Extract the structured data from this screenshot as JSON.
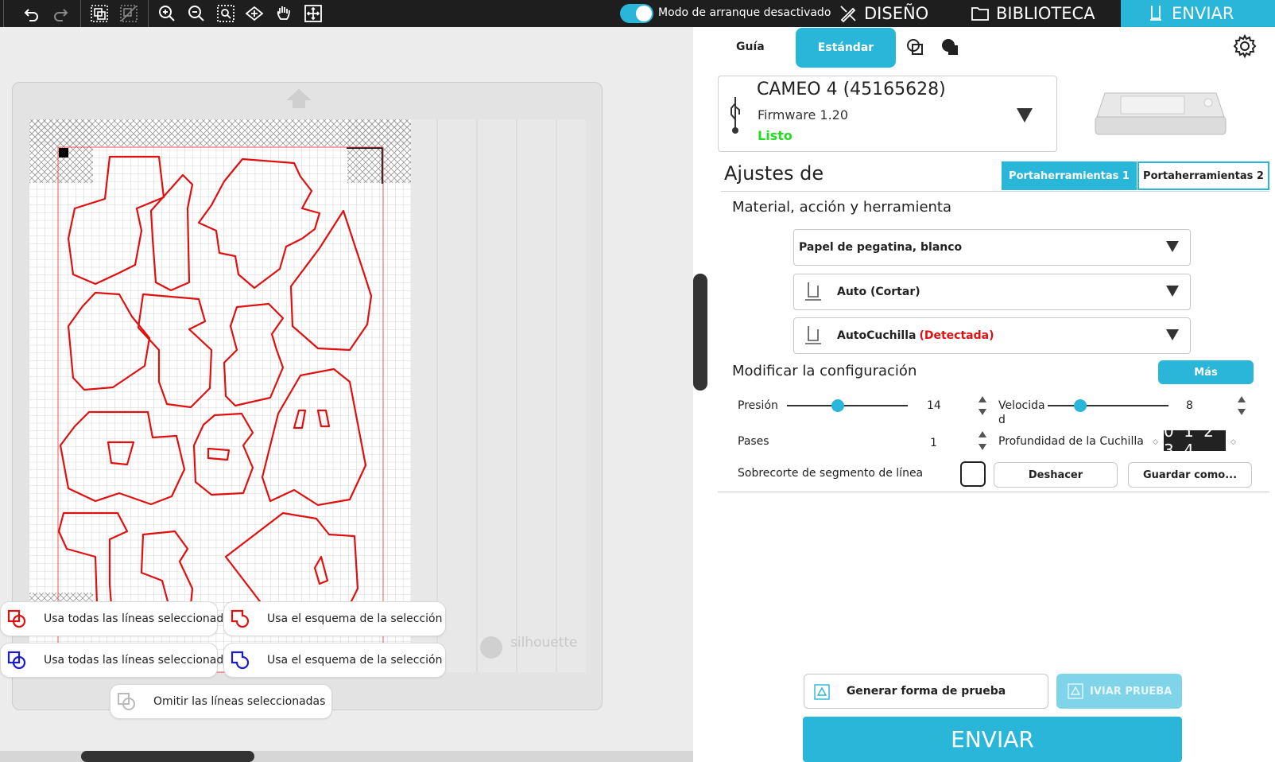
{
  "topbar": {
    "mode_label": "Modo de arranque desactivado",
    "tabs": [
      {
        "label": "DISEÑO"
      },
      {
        "label": "BIBLIOTECA"
      },
      {
        "label": "ENVIAR"
      }
    ]
  },
  "canvas": {
    "brand": "silhouette",
    "options": [
      {
        "label": "Usa todas las líneas seleccionadas",
        "color": "#e01010"
      },
      {
        "label": "Usa el esquema de la selección",
        "color": "#e01010"
      },
      {
        "label": "Usa todas las líneas seleccionadas",
        "color": "#1a1ad0"
      },
      {
        "label": "Usa el esquema de la selección",
        "color": "#1a1ad0"
      },
      {
        "label": "Omitir las líneas seleccionadas",
        "color": "#bbbbbb"
      }
    ]
  },
  "panel": {
    "tabs": {
      "guide": "Guía",
      "standard": "Estándar"
    },
    "machine": {
      "name": "CAMEO 4 (45165628)",
      "firmware": "Firmware 1.20",
      "status": "Listo"
    },
    "settings_title": "Ajustes de",
    "toolholders": [
      "Portaherramientas 1",
      "Portaherramientas 2"
    ],
    "material_section": "Material, acción y herramienta",
    "material": "Papel de pegatina, blanco",
    "action": "Auto (Cortar)",
    "tool": "AutoCuchilla",
    "tool_status": "(Detectada)",
    "modify_title": "Modificar la configuración",
    "more_label": "Más",
    "pressure": {
      "label": "Presión",
      "value": "14",
      "level": 0.42
    },
    "speed": {
      "label_line1": "Velocida",
      "label_line2": "d",
      "value": "8",
      "level": 0.27
    },
    "passes": {
      "label": "Pases",
      "value": "1"
    },
    "depth": {
      "label": "Profundidad de la Cuchilla",
      "display": "0 1 2 3 4"
    },
    "overcut_label": "Sobrecorte de segmento de línea",
    "undo_label": "Deshacer",
    "save_as_label": "Guardar como...",
    "test_cut_label": "Generar forma de prueba",
    "send_test_label": "IVIAR PRUEBA",
    "send_label": "ENVIAR"
  },
  "colors": {
    "accent": "#29b6d8",
    "cut_line": "#e01010",
    "ready": "#22dd22"
  }
}
